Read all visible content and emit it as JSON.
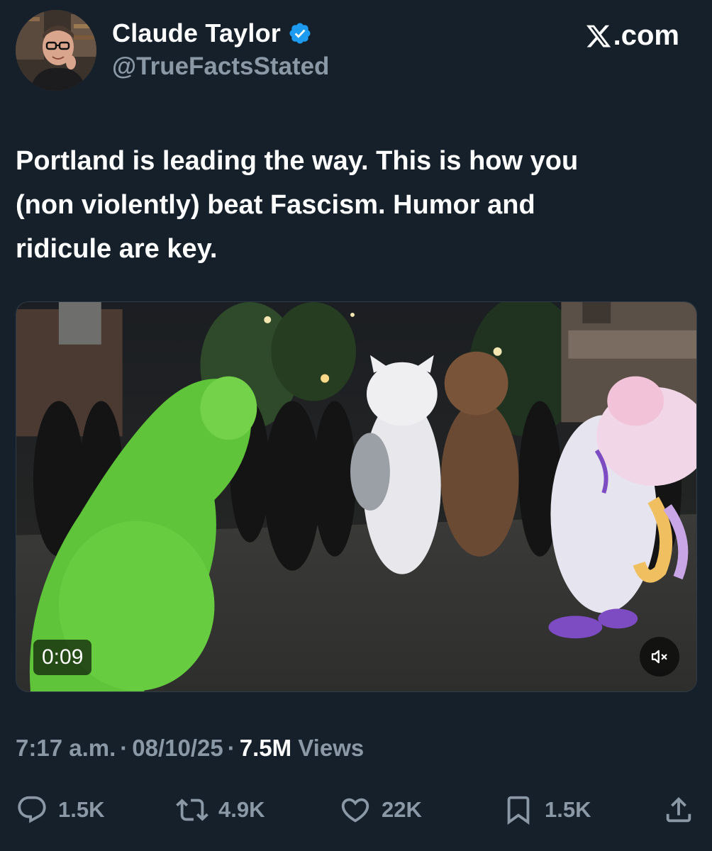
{
  "author": {
    "display_name": "Claude Taylor",
    "handle": "@TrueFactsStated",
    "verified": true
  },
  "brand": {
    "label": ".com",
    "icon": "x-logo-icon"
  },
  "tweet": {
    "text_lines": [
      "Portland is leading the way. This is how you",
      "(non violently) beat Fascism. Humor and",
      "ridicule are key."
    ]
  },
  "media": {
    "type": "video",
    "duration": "0:09",
    "mute_icon": "speaker-muted-icon"
  },
  "meta": {
    "time": "7:17 a.m.",
    "date": "08/10/25",
    "views_count": "7.5M",
    "views_label": "Views"
  },
  "actions": {
    "replies": "1.5K",
    "reposts": "4.9K",
    "likes": "22K",
    "bookmarks": "1.5K"
  },
  "colors": {
    "background": "#15202b",
    "text": "#ffffff",
    "muted": "#8b98a5",
    "verified": "#1d9bf0"
  }
}
